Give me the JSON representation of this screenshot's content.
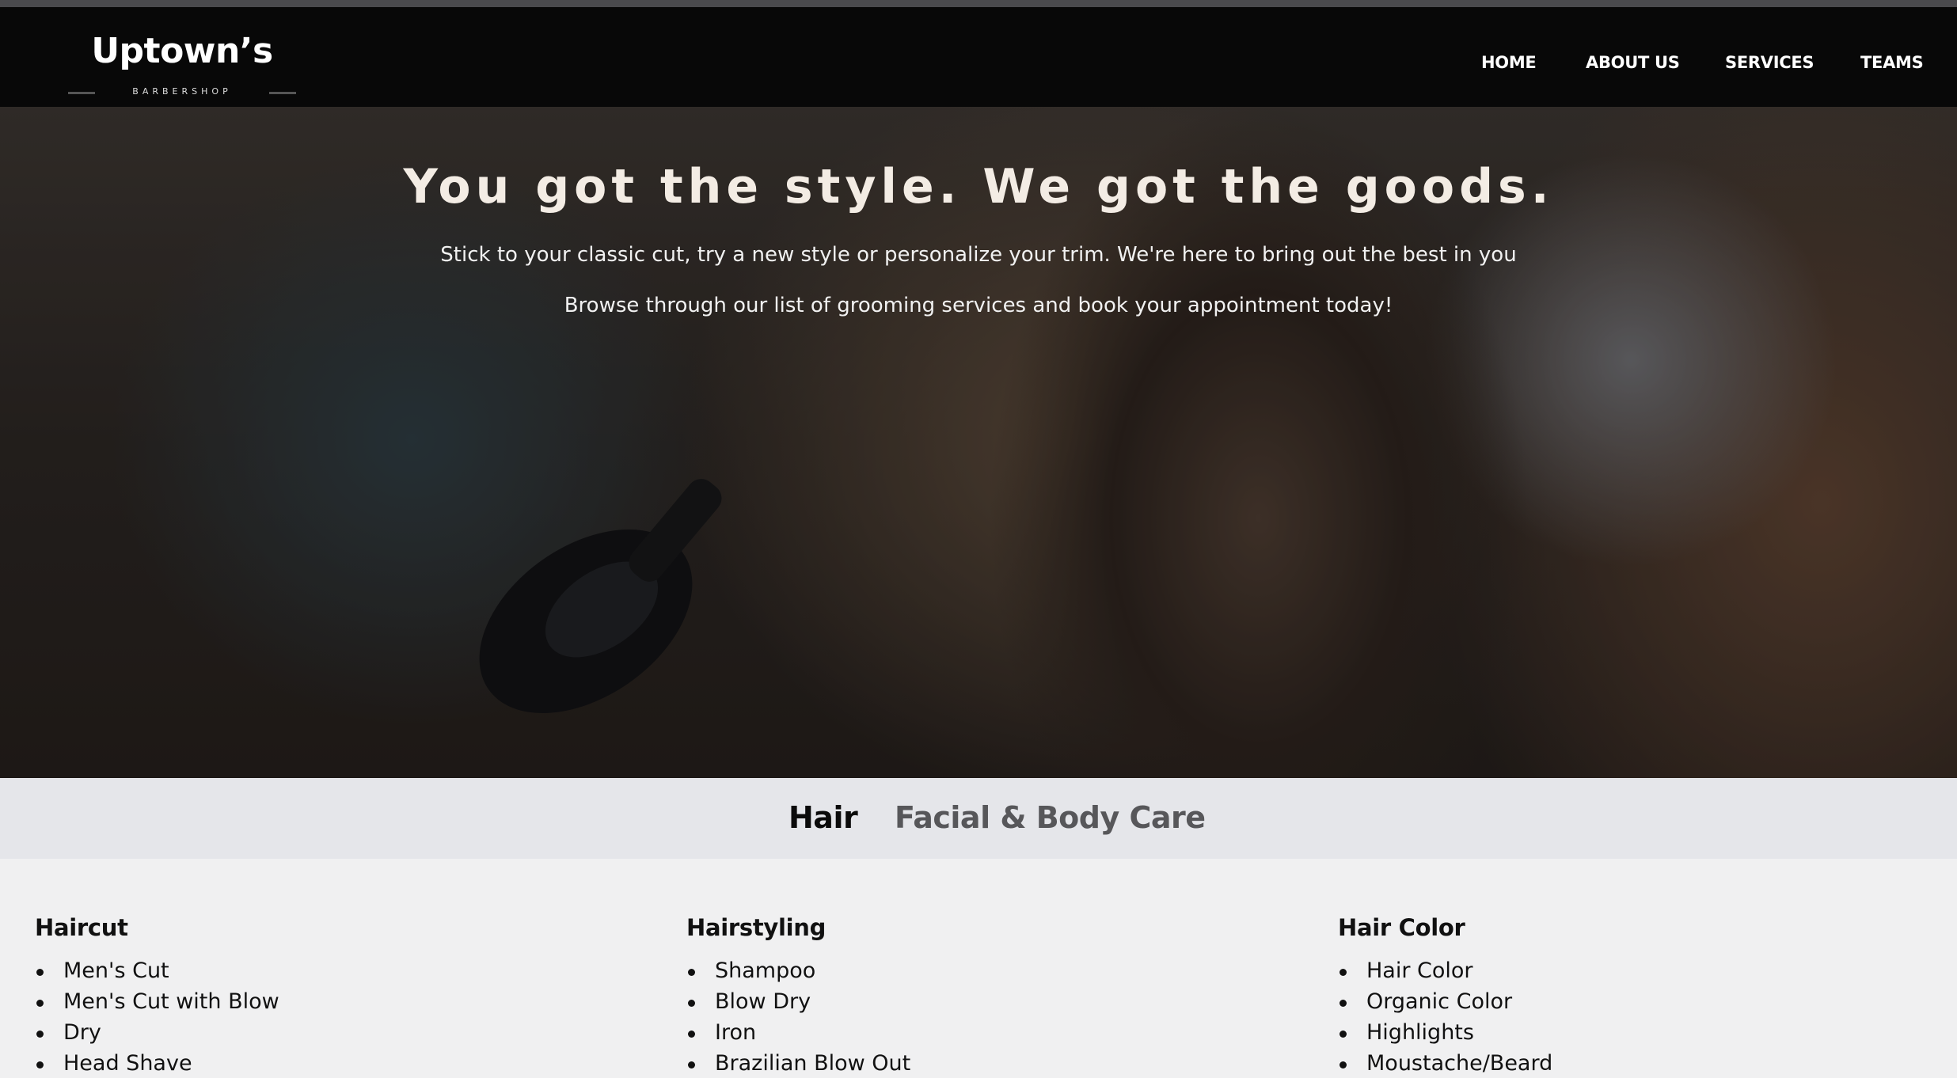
{
  "brand": {
    "name": "Uptown’s",
    "tagline": "BARBERSHOP"
  },
  "nav": {
    "items": [
      {
        "label": "HOME"
      },
      {
        "label": "ABOUT US"
      },
      {
        "label": "SERVICES"
      },
      {
        "label": "TEAMS"
      }
    ]
  },
  "hero": {
    "title": "You got the style. We got the goods.",
    "subtitle_1": "Stick to your classic cut, try a new style or personalize your trim. We're here to bring out the best in you",
    "subtitle_2": "Browse through our list of grooming services and book your appointment today!"
  },
  "tabs": [
    {
      "label": "Hair",
      "active": true
    },
    {
      "label": "Facial & Body Care",
      "active": false
    }
  ],
  "services": [
    {
      "title": "Haircut",
      "items": [
        "Men's Cut",
        "Men's Cut with Blow",
        "Dry",
        "Head Shave"
      ]
    },
    {
      "title": "Hairstyling",
      "items": [
        "Shampoo",
        "Blow Dry",
        "Iron",
        "Brazilian Blow Out"
      ]
    },
    {
      "title": "Hair Color",
      "items": [
        "Hair Color",
        "Organic Color",
        "Highlights",
        "Moustache/Beard"
      ]
    }
  ],
  "colors": {
    "navbar_bg": "#080808",
    "tabbar_bg": "#e5e6ea",
    "page_bg": "#f0f0f1",
    "active_tab": "#0b0b0b",
    "inactive_tab": "#57575a"
  }
}
